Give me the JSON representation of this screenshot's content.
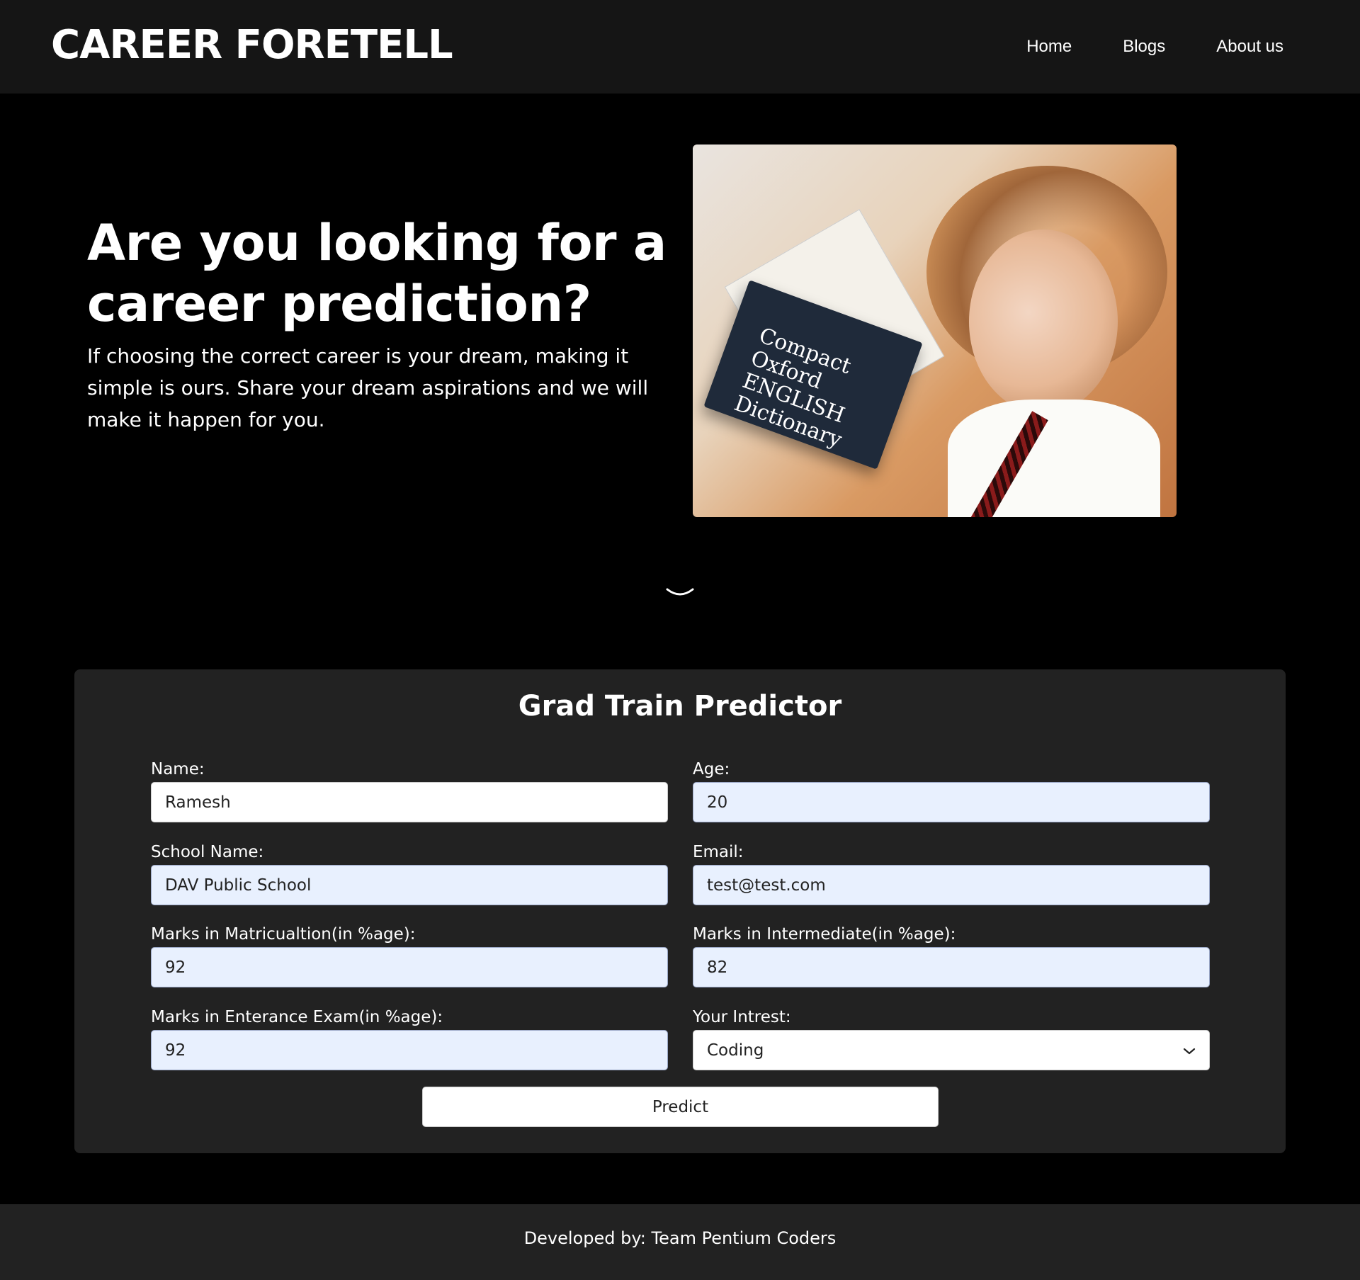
{
  "header": {
    "brand": "CAREER FORETELL",
    "nav": [
      {
        "label": "Home"
      },
      {
        "label": "Blogs"
      },
      {
        "label": "About us"
      }
    ]
  },
  "hero": {
    "title": "Are you looking for a career prediction?",
    "subtitle": "If choosing the correct career is your dream, making it simple is ours. Share your dream aspirations and we will make it happen for you.",
    "image_book_text": "Compact Oxford ENGLISH Dictionary",
    "scroll_icon": "chevron-down-icon"
  },
  "form": {
    "title": "Grad Train Predictor",
    "fields": {
      "name": {
        "label": "Name:",
        "value": "Ramesh"
      },
      "age": {
        "label": "Age:",
        "value": "20"
      },
      "school": {
        "label": "School Name:",
        "value": "DAV Public School"
      },
      "email": {
        "label": "Email:",
        "value": "test@test.com"
      },
      "matric": {
        "label": "Marks in Matricualtion(in %age):",
        "value": "92"
      },
      "intermediate": {
        "label": "Marks in Intermediate(in %age):",
        "value": "82"
      },
      "entrance": {
        "label": "Marks in Enterance Exam(in %age):",
        "value": "92"
      },
      "interest": {
        "label": "Your Intrest:",
        "selected": "Coding"
      }
    },
    "submit_label": "Predict"
  },
  "footer": {
    "text": "Developed by: Team Pentium Coders"
  },
  "colors": {
    "background": "#000000",
    "header_bg": "#151515",
    "card_bg": "#222222",
    "autofill_bg": "#e8f0fe"
  }
}
